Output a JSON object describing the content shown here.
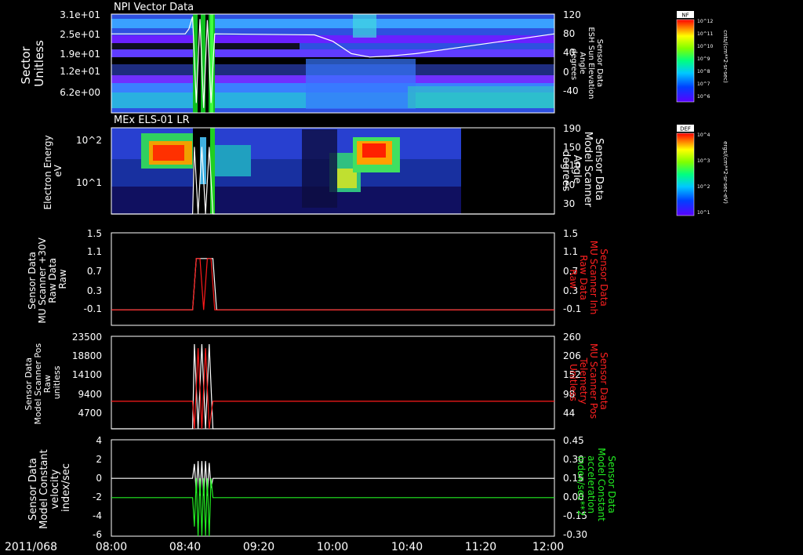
{
  "x_axis": {
    "date_label": "2011/068",
    "ticks": [
      "08:00",
      "08:40",
      "09:20",
      "10:00",
      "10:40",
      "11:20",
      "12:00"
    ],
    "range": [
      "08:00",
      "12:00"
    ]
  },
  "colorbars": [
    {
      "label": "NF",
      "units": "cnts/(cm**2-sr-sec)",
      "ticks": [
        "10^12",
        "10^11",
        "10^10",
        "10^9",
        "10^8",
        "10^7",
        "10^6"
      ]
    },
    {
      "label": "DEF",
      "units": "ergs/(cm**2-sr-sec-eV)",
      "ticks": [
        "10^4",
        "10^3",
        "10^2",
        "10^1"
      ]
    }
  ],
  "colors": {
    "white_trace": "#ffffff",
    "red_trace": "#ff1a1a",
    "green_trace": "#22ee22",
    "red_label": "#ff2020",
    "green_label": "#22ee22"
  },
  "chart_data": [
    {
      "type": "heatmap",
      "title": "NPI Vector Data",
      "ylabel": "Sector\nUnitless",
      "y_ticks": [
        "3.1e+01",
        "2.5e+01",
        "1.9e+01",
        "1.2e+01",
        "6.2e+00"
      ],
      "right_ylabel": "Sensor Data\nESH Sun Elevation\nAngle\ndegrees",
      "right_ylim": [
        -80,
        120
      ],
      "right_ticks": [
        "120",
        "80",
        "40",
        "0",
        "-40"
      ],
      "overlay_series": {
        "name": "Sensor Data ESH Sun Elevation Angle",
        "color": "white",
        "x": [
          "08:00",
          "08:40",
          "08:42",
          "08:44",
          "08:46",
          "08:48",
          "08:50",
          "08:52",
          "08:54",
          "08:56",
          "09:50",
          "10:00",
          "10:10",
          "10:20",
          "10:30",
          "10:45",
          "12:00"
        ],
        "y": [
          80,
          80,
          90,
          115,
          -60,
          110,
          -70,
          108,
          -60,
          80,
          78,
          65,
          40,
          33,
          35,
          40,
          80
        ]
      }
    },
    {
      "type": "heatmap",
      "title": "MEx ELS-01 LR",
      "ylabel": "Electron Energy\neV",
      "y_scale": "log",
      "y_ticks": [
        "10^2",
        "10^1"
      ],
      "right_ylabel": "Sensor Data\nModel Scanner\nAngle\ndegrees",
      "right_ylim": [
        10,
        190
      ],
      "right_ticks": [
        "190",
        "150",
        "110",
        "70",
        "30"
      ],
      "overlay_series": {
        "name": "Sensor Data Model Scanner Angle",
        "color": "white",
        "x": [
          "08:00",
          "08:44",
          "08:45",
          "08:47",
          "08:49",
          "08:51",
          "08:53",
          "08:55",
          "12:00"
        ],
        "y": [
          10,
          10,
          150,
          10,
          150,
          10,
          150,
          10,
          10
        ]
      }
    },
    {
      "type": "line",
      "ylabel": "Sensor Data\nMU Scanner +30V\nRaw Data\nRaw",
      "ylim": [
        -0.3,
        1.5
      ],
      "y_ticks": [
        "1.5",
        "1.1",
        "0.7",
        "0.3",
        "-0.1"
      ],
      "right_ylabel": "Sensor Data\nMU Scanner Inh\nRaw Data\nRaw",
      "right_ylim": [
        -0.3,
        1.5
      ],
      "right_ticks": [
        "1.5",
        "1.1",
        "0.7",
        "0.3",
        "-0.1"
      ],
      "series": [
        {
          "color": "white",
          "x": [
            "08:00",
            "08:44",
            "08:46",
            "08:55",
            "08:57",
            "12:00"
          ],
          "y": [
            0,
            0,
            1,
            1,
            0,
            0
          ]
        },
        {
          "color": "red",
          "x": [
            "08:00",
            "08:44",
            "08:46",
            "08:48",
            "08:50",
            "08:52",
            "08:54",
            "08:56",
            "12:00"
          ],
          "y": [
            0,
            0,
            1,
            1,
            0,
            1,
            1,
            0,
            0
          ]
        }
      ]
    },
    {
      "type": "line",
      "ylabel": "Sensor Data\nModel Scanner Pos\nRaw\nunitless",
      "ylim": [
        0,
        23500
      ],
      "y_ticks": [
        "23500",
        "18800",
        "14100",
        "9400",
        "4700"
      ],
      "right_ylabel": "Sensor Data\nMU Scanner Pos\nTelemetry\nUnitless",
      "right_ylim": [
        0,
        260
      ],
      "right_ticks": [
        "260",
        "206",
        "152",
        "98",
        "44"
      ],
      "series": [
        {
          "color": "white",
          "x": [
            "08:00",
            "08:44",
            "08:45",
            "08:47",
            "08:49",
            "08:51",
            "08:53",
            "08:55",
            "12:00"
          ],
          "y": [
            0,
            0,
            21500,
            0,
            21500,
            0,
            21500,
            0,
            0
          ]
        },
        {
          "color": "red",
          "x": [
            "08:00",
            "08:44",
            "08:45",
            "08:47",
            "08:49",
            "08:51",
            "08:53",
            "08:55",
            "12:00"
          ],
          "y": [
            7000,
            7000,
            0,
            20500,
            0,
            20500,
            0,
            7000,
            7000
          ]
        }
      ]
    },
    {
      "type": "line",
      "ylabel": "Sensor Data\nModel Constant\nvelocity\nindex/sec",
      "ylim": [
        -6,
        4
      ],
      "y_ticks": [
        "4",
        "2",
        "0",
        "-2",
        "-4",
        "-6"
      ],
      "right_ylabel": "Sensor Data\nModel Constant\nacceleration\nindex/sec**2",
      "right_ylim": [
        -0.3,
        0.45
      ],
      "right_ticks": [
        "0.45",
        "0.30",
        "0.15",
        "0.00",
        "-0.15",
        "-0.30"
      ],
      "series": [
        {
          "color": "white",
          "x": [
            "08:00",
            "08:44",
            "08:45",
            "08:46",
            "08:47",
            "08:48",
            "08:49",
            "08:50",
            "08:51",
            "08:52",
            "08:53",
            "08:54",
            "08:55",
            "12:00"
          ],
          "y": [
            0,
            0,
            1.5,
            -1.5,
            1.8,
            -1.8,
            1.8,
            -1.8,
            1.8,
            -1.8,
            1.6,
            -1,
            0,
            0
          ]
        },
        {
          "color": "green",
          "x": [
            "08:00",
            "08:44",
            "08:45",
            "08:46",
            "08:47",
            "08:48",
            "08:49",
            "08:50",
            "08:51",
            "08:52",
            "08:53",
            "08:54",
            "08:55",
            "12:00"
          ],
          "y": [
            -2,
            -2,
            -5,
            0,
            -6,
            0,
            -6,
            0,
            -6,
            0,
            -6,
            0,
            -2,
            -2
          ]
        }
      ]
    }
  ]
}
